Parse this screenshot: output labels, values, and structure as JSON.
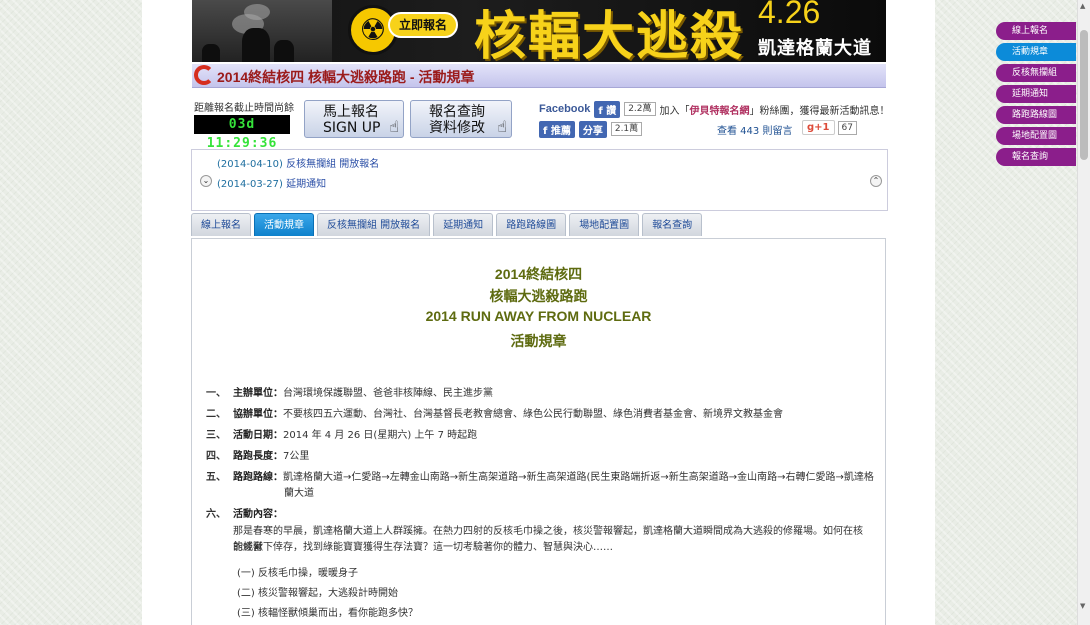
{
  "banner": {
    "signup_pill": "立即報名",
    "title": "核輻大逃殺",
    "date": "4.26",
    "location": "凱達格蘭大道"
  },
  "title_bar": {
    "text": "2014終結核四 核輻大逃殺路跑 - 活動規章"
  },
  "countdown": {
    "label": "距離報名截止時間尚餘",
    "value": "03d 11:29:36"
  },
  "buttons": {
    "signup": {
      "line1": "馬上報名",
      "line2": "SIGN UP"
    },
    "query": {
      "line1": "報名查詢",
      "line2": "資料修改"
    }
  },
  "social": {
    "facebook_word": "Facebook",
    "like_btn": "讚",
    "like_count": "2.2萬",
    "join_prefix": "加入「",
    "join_link": "伊貝特報名網",
    "join_suffix": "」粉絲團，獲得最新活動訊息！",
    "recommend_btn": "推薦",
    "share_btn": "分享",
    "share_count": "2.1萬",
    "comments": "查看 443 則留言",
    "gplus_label": "+1",
    "gplus_count": "67"
  },
  "news": [
    {
      "date": "(2014-04-10)",
      "text": "反核無攔組 開放報名"
    },
    {
      "date": "(2014-03-27)",
      "text": "延期通知"
    }
  ],
  "tabs": [
    {
      "label": "線上報名",
      "active": false
    },
    {
      "label": "活動規章",
      "active": true
    },
    {
      "label": "反核無攔組 開放報名",
      "active": false
    },
    {
      "label": "延期通知",
      "active": false
    },
    {
      "label": "路跑路線圖",
      "active": false
    },
    {
      "label": "場地配置圖",
      "active": false
    },
    {
      "label": "報名查詢",
      "active": false
    }
  ],
  "content": {
    "headlines": [
      "2014終結核四",
      "核輻大逃殺路跑",
      "2014 RUN AWAY FROM NUCLEAR",
      "活動規章"
    ],
    "rules": [
      {
        "num": "一、",
        "key": "主辦單位：",
        "val": "台灣環境保護聯盟、爸爸非核陣線、民主進步黨"
      },
      {
        "num": "二、",
        "key": "協辦單位：",
        "val": "不要核四五六運動、台灣社、台灣基督長老教會總會、綠色公民行動聯盟、綠色消費者基金會、新境界文教基金會"
      },
      {
        "num": "三、",
        "key": "活動日期：",
        "val": "2014 年 4 月 26 日(星期六) 上午 7 時起跑"
      },
      {
        "num": "四、",
        "key": "路跑長度：",
        "val": "7公里"
      },
      {
        "num": "五、",
        "key": "路跑路線：",
        "val": "凱達格蘭大道→仁愛路→左轉金山南路→新生高架道路→新生高架道路(民生東路端折返→新生高架道路→金山南路→右轉仁愛路→凱達格"
      },
      {
        "num": "",
        "key": "",
        "val": "蘭大道"
      },
      {
        "num": "六、",
        "key": "活動內容：",
        "val": ""
      }
    ],
    "paragraph_1": "那是春寒的早晨，凱達格蘭大道上人群蹊擁。在熱力四射的反核毛巾操之後，核災警報響起，凱達格蘭大道瞬間成為大逃殺的修羅場。如何在核能怪獸",
    "paragraph_2": "的威脅下倖存，找到綠能寶寶獲得生存法寶？這一切考驗著你的體力、智慧與決心……",
    "list": [
      "(一) 反核毛巾操，暖暖身子",
      "(二) 核災警報響起，大逃殺計時開始",
      "(三) 核輻怪獸傾巢而出，看你能跑多快？"
    ]
  },
  "sidenav": [
    {
      "label": "線上報名",
      "active": false
    },
    {
      "label": "活動規章",
      "active": true
    },
    {
      "label": "反核無攔組",
      "active": false
    },
    {
      "label": "延期通知",
      "active": false
    },
    {
      "label": "路跑路線圖",
      "active": false
    },
    {
      "label": "場地配置圖",
      "active": false
    },
    {
      "label": "報名查詢",
      "active": false
    }
  ]
}
